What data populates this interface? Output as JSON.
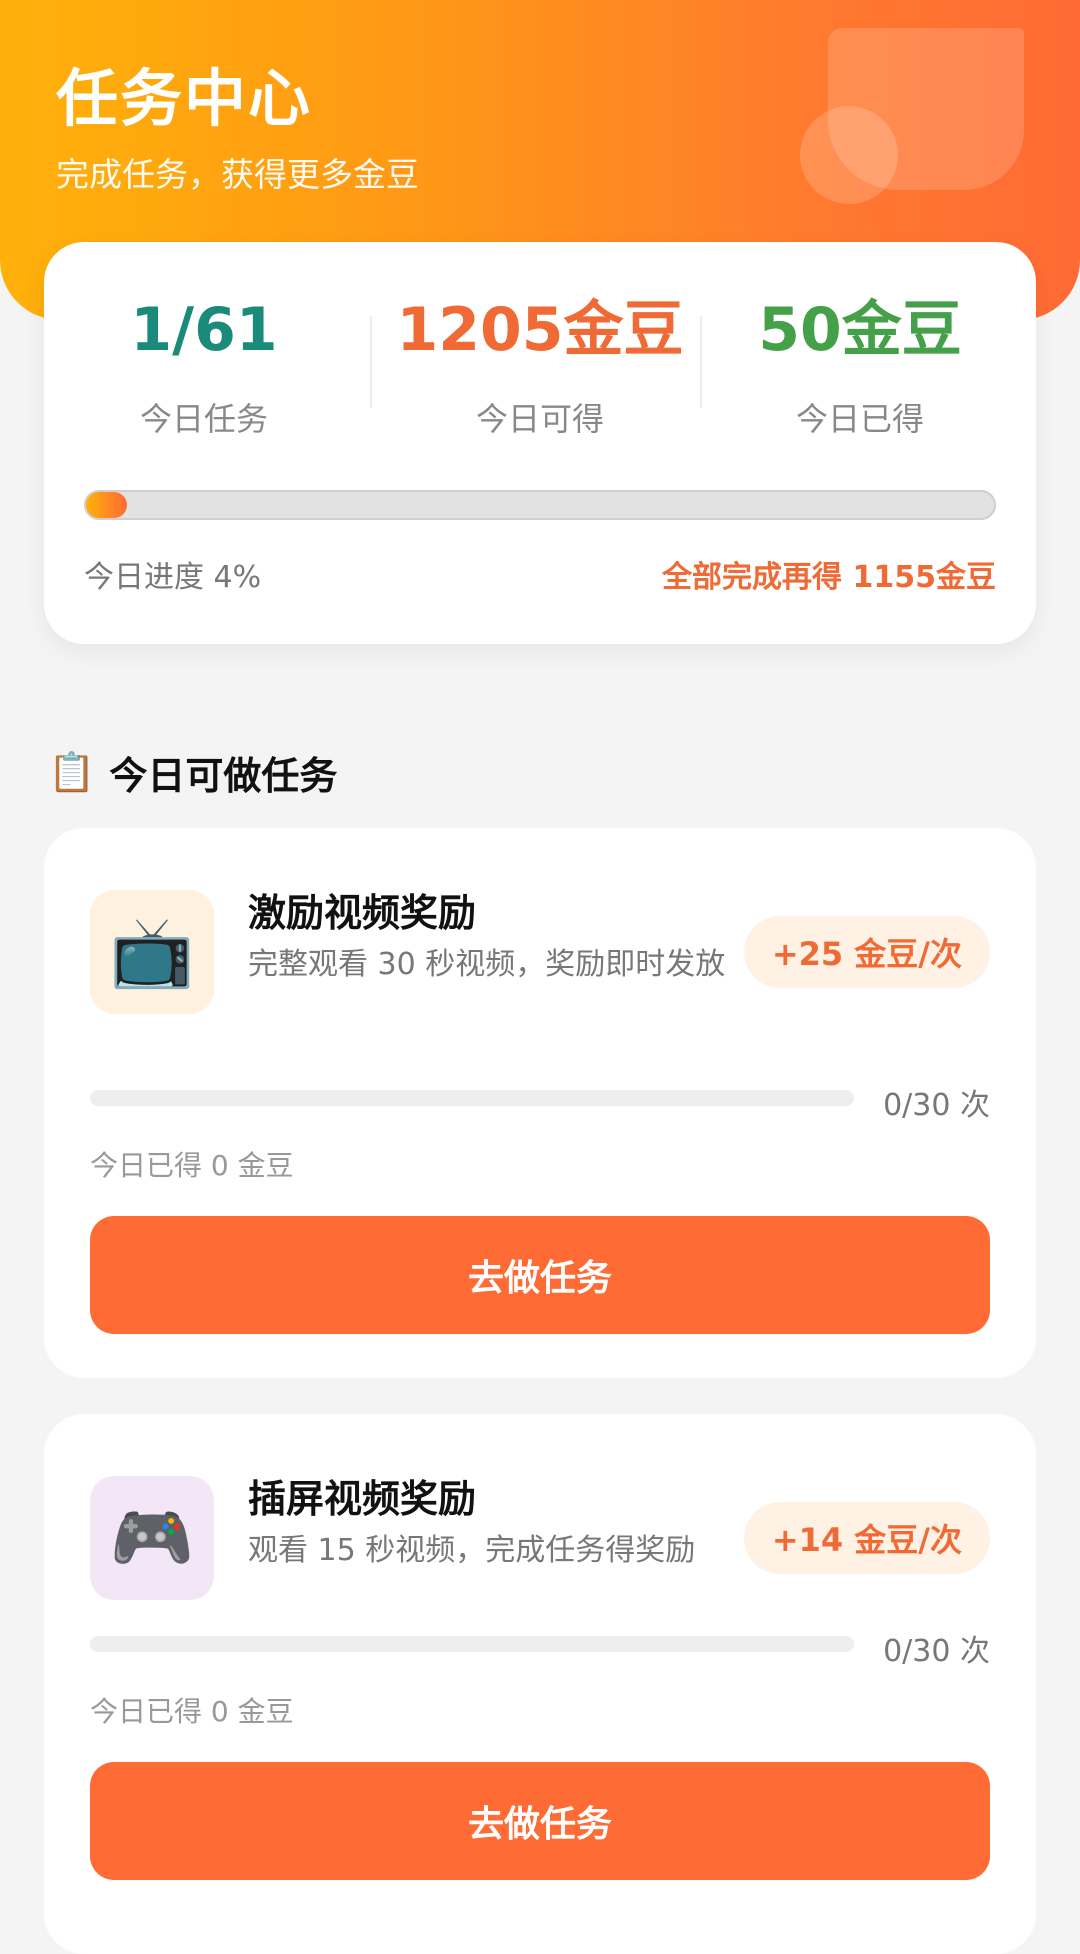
{
  "header": {
    "title": "任务中心",
    "subtitle": "完成任务，获得更多金豆"
  },
  "summary": {
    "stats": [
      {
        "value": "1/61",
        "label": "今日任务"
      },
      {
        "value": "1205金豆",
        "label": "今日可得"
      },
      {
        "value": "50金豆",
        "label": "今日已得"
      }
    ],
    "progress_percent": 4,
    "progress_label": "今日进度 4%",
    "bonus_label": "全部完成再得 1155金豆",
    "colors": {
      "task_count": "#1a8a7a",
      "available": "#f06a35",
      "earned": "#45a04a"
    }
  },
  "section": {
    "icon": "clipboard-icon",
    "title": "今日可做任务"
  },
  "tasks": [
    {
      "icon": "television-icon",
      "icon_glyph": "📺",
      "name": "激励视频奖励",
      "description": "完整观看 30 秒视频，奖励即时发放",
      "reward": "+25 金豆/次",
      "progress_done": 0,
      "progress_total": 30,
      "count_text": "0/30 次",
      "earned_text": "今日已得 0 金豆",
      "button_label": "去做任务"
    },
    {
      "icon": "game-controller-icon",
      "icon_glyph": "🎮",
      "name": "插屏视频奖励",
      "description": "观看 15 秒视频，完成任务得奖励",
      "reward": "+14 金豆/次",
      "progress_done": 0,
      "progress_total": 30,
      "count_text": "0/30 次",
      "earned_text": "今日已得 0 金豆",
      "button_label": "去做任务"
    }
  ],
  "accent_color": "#ff6b35"
}
